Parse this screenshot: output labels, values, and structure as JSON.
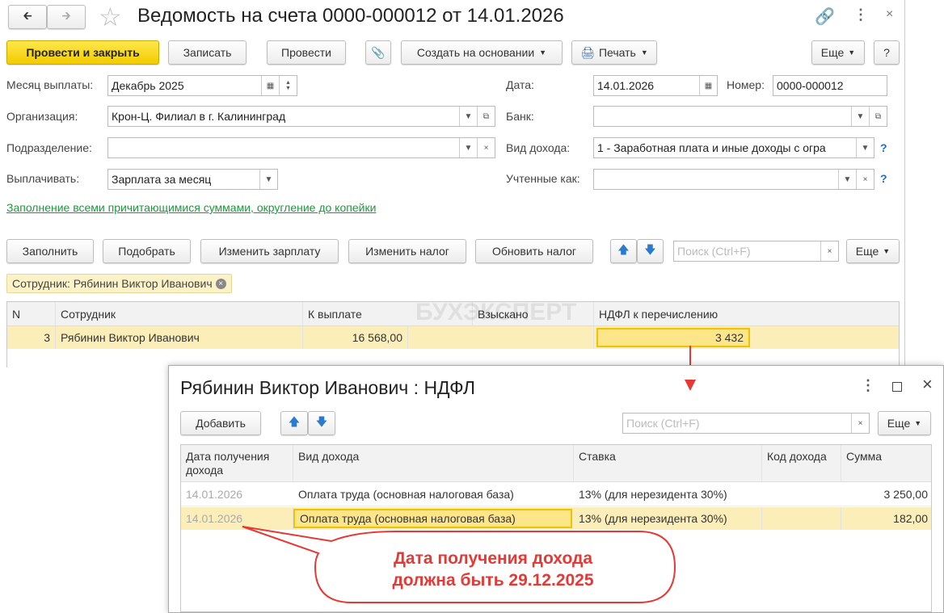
{
  "main": {
    "title": "Ведомость на счета 0000-000012 от 14.01.2026",
    "toolbar": {
      "post_close": "Провести и закрыть",
      "save": "Записать",
      "post": "Провести",
      "create_based": "Создать на основании",
      "print": "Печать",
      "more": "Еще",
      "help": "?"
    },
    "fields": {
      "month_label": "Месяц выплаты:",
      "month_value": "Декабрь 2025",
      "date_label": "Дата:",
      "date_value": "14.01.2026",
      "number_label": "Номер:",
      "number_value": "0000-000012",
      "org_label": "Организация:",
      "org_value": "Крон-Ц. Филиал в г. Калининград",
      "bank_label": "Банк:",
      "bank_value": "",
      "dept_label": "Подразделение:",
      "dept_value": "",
      "income_label": "Вид дохода:",
      "income_value": "1 - Заработная плата и иные доходы с огра",
      "pay_label": "Выплачивать:",
      "pay_value": "Зарплата за месяц",
      "counted_label": "Учтенные как:",
      "counted_value": ""
    },
    "fill_link": "Заполнение всеми причитающимися суммами, округление до копейки",
    "table_toolbar": {
      "fill": "Заполнить",
      "pick": "Подобрать",
      "change_salary": "Изменить зарплату",
      "change_tax": "Изменить налог",
      "update_tax": "Обновить налог",
      "search_placeholder": "Поиск (Ctrl+F)",
      "more": "Еще"
    },
    "filter": "Сотрудник: Рябинин Виктор Иванович",
    "watermark": "БУХЭКСПЕРТ",
    "columns": [
      "N",
      "Сотрудник",
      "К выплате",
      "Взыскано",
      "НДФЛ к перечислению"
    ],
    "rows": [
      {
        "n": "3",
        "employee": "Рябинин Виктор Иванович",
        "to_pay": "16 568,00",
        "collected": "",
        "ndfl": "3 432"
      }
    ]
  },
  "popup": {
    "title": "Рябинин Виктор Иванович : НДФЛ",
    "add": "Добавить",
    "search_placeholder": "Поиск (Ctrl+F)",
    "more": "Еще",
    "columns": [
      "Дата получения дохода",
      "Вид дохода",
      "Ставка",
      "Код дохода",
      "Сумма"
    ],
    "rows": [
      {
        "date": "14.01.2026",
        "type": "Оплата труда (основная налоговая база)",
        "rate": "13% (для нерезидента 30%)",
        "code": "",
        "sum": "3 250,00"
      },
      {
        "date": "14.01.2026",
        "type": "Оплата труда (основная налоговая база)",
        "rate": "13% (для нерезидента 30%)",
        "code": "",
        "sum": "182,00"
      }
    ]
  },
  "callout": {
    "line1": "Дата получения дохода",
    "line2": "должна быть 29.12.2025"
  },
  "colors": {
    "accent": "#f2cc00",
    "link": "#1a9a3a",
    "callout": "#e53935",
    "selected": "#fbeeb8"
  }
}
